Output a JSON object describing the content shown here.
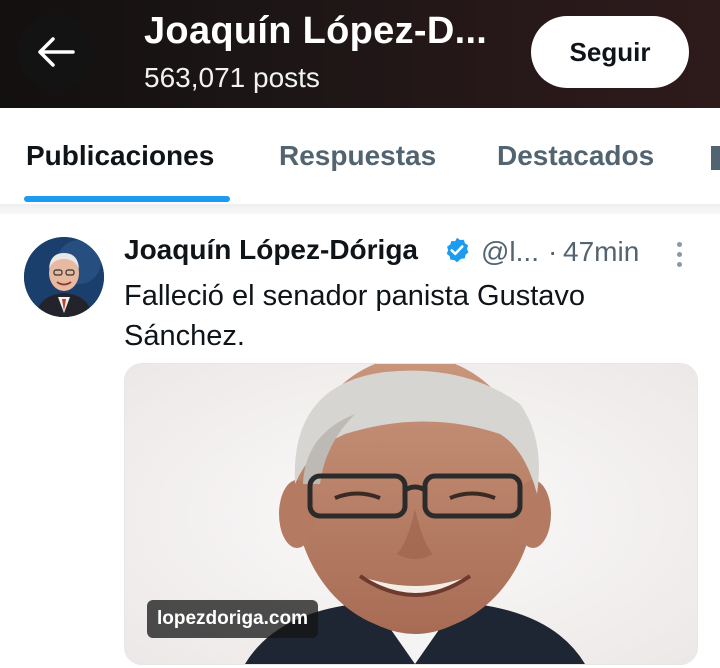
{
  "header": {
    "title": "Joaquín López-D...",
    "posts_count": "563,071 posts",
    "follow_label": "Seguir"
  },
  "tabs": [
    {
      "label": "Publicaciones",
      "active": true
    },
    {
      "label": "Respuestas",
      "active": false
    },
    {
      "label": "Destacados",
      "active": false
    }
  ],
  "post": {
    "author_name": "Joaquín López-Dóriga",
    "handle": "@l...",
    "separator": "·",
    "time": "47min",
    "text": "Falleció el senador panista Gustavo Sánchez.",
    "media_source": "lopezdoriga.com"
  },
  "colors": {
    "accent": "#1d9bf0",
    "text_primary": "#0f1419",
    "text_secondary": "#536471"
  },
  "icons": {
    "back": "arrow-left-icon",
    "verified": "verified-badge-icon",
    "more": "more-vertical-icon"
  }
}
